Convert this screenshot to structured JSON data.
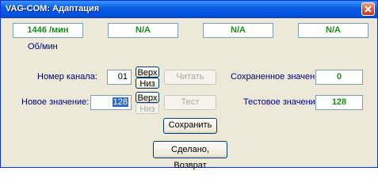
{
  "window": {
    "title": "VAG-COM: Адаптация"
  },
  "top_fields": [
    "1446 /мин",
    "N/A",
    "N/A",
    "N/A"
  ],
  "rpm_unit": "Об/мин",
  "channel": {
    "label": "Номер канала:",
    "value": "01"
  },
  "up_label": "Верх",
  "down_label": "Низ",
  "read_button": "Читать",
  "saved_value": {
    "label": "Сохраненное значение:",
    "value": "0"
  },
  "new_value": {
    "label": "Новое значение:",
    "value": "128"
  },
  "test_button": "Тест",
  "test_value": {
    "label": "Тестовое значение:",
    "value": "128"
  },
  "save_button": "Сохранить",
  "done_button": "Сделано, Возврат",
  "colors": {
    "title_bar": "#0054e3",
    "value_green": "#1a8a1a",
    "label_navy": "#000080",
    "close_red": "#d4573a"
  }
}
